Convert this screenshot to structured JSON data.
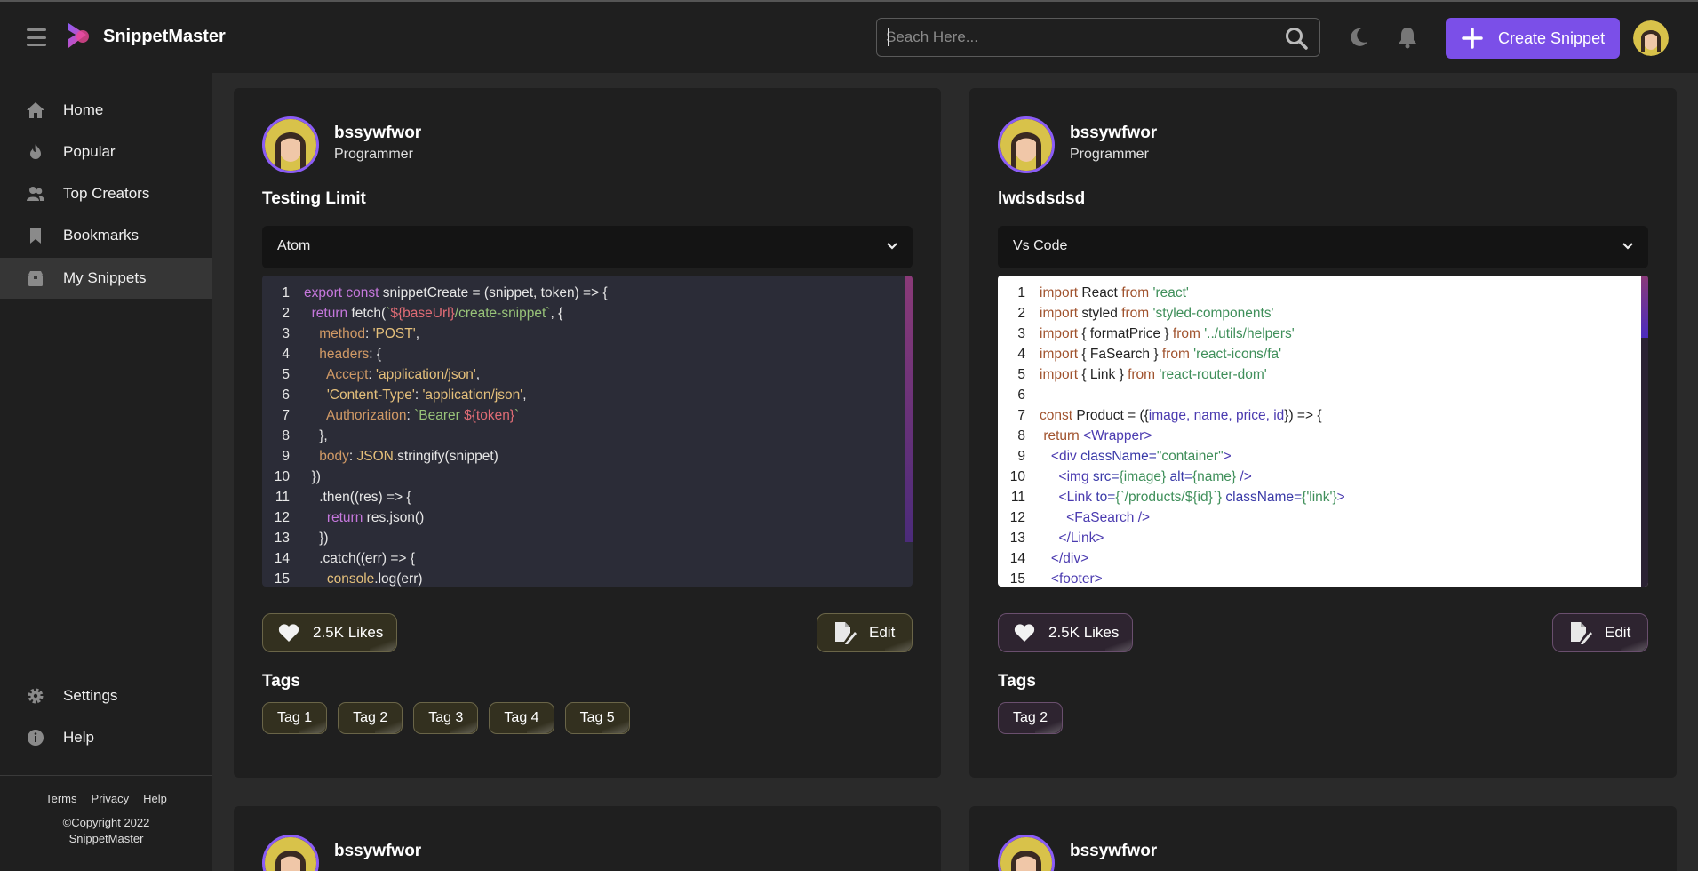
{
  "app": {
    "name": "SnippetMaster"
  },
  "search": {
    "placeholder": "Seach Here..."
  },
  "header": {
    "create_label": "Create Snippet"
  },
  "sidebar": {
    "items": [
      {
        "label": "Home",
        "icon": "home-icon"
      },
      {
        "label": "Popular",
        "icon": "fire-icon"
      },
      {
        "label": "Top Creators",
        "icon": "users-icon"
      },
      {
        "label": "Bookmarks",
        "icon": "bookmark-icon"
      },
      {
        "label": "My Snippets",
        "icon": "box-icon",
        "active": true
      }
    ],
    "bottom_items": [
      {
        "label": "Settings",
        "icon": "gear-icon"
      },
      {
        "label": "Help",
        "icon": "info-icon"
      }
    ],
    "footer_links": [
      "Terms",
      "Privacy",
      "Help"
    ],
    "copyright_line1": "©Copyright 2022",
    "copyright_line2": "SnippetMaster"
  },
  "cards": [
    {
      "username": "bssywfwor",
      "role": "Programmer",
      "title": "Testing Limit",
      "editor": "Atom",
      "likes": "2.5K Likes",
      "edit_label": "Edit",
      "tags_heading": "Tags",
      "tags": [
        "Tag 1",
        "Tag 2",
        "Tag 3",
        "Tag 4",
        "Tag 5"
      ]
    },
    {
      "username": "bssywfwor",
      "role": "Programmer",
      "title": "lwdsdsdsd",
      "editor": "Vs Code",
      "likes": "2.5K Likes",
      "edit_label": "Edit",
      "tags_heading": "Tags",
      "tags": [
        "Tag 2"
      ]
    },
    {
      "username": "bssywfwor"
    },
    {
      "username": "bssywfwor"
    }
  ],
  "code": {
    "card1": [
      "export const snippetCreate = (snippet, token) => {",
      "  return fetch(`${baseUrl}/create-snippet`, {",
      "    method: 'POST',",
      "    headers: {",
      "      Accept: 'application/json',",
      "      'Content-Type': 'application/json',",
      "      Authorization: `Bearer ${token}`",
      "    },",
      "    body: JSON.stringify(snippet)",
      "  })",
      "    .then((res) => {",
      "      return res.json()",
      "    })",
      "    .catch((err) => {",
      "      console.log(err)"
    ],
    "card2": [
      "import React from 'react'",
      "import styled from 'styled-components'",
      "import { formatPrice } from '../utils/helpers'",
      "import { FaSearch } from 'react-icons/fa'",
      "import { Link } from 'react-router-dom'",
      "",
      "const Product = ({image, name, price, id}) => {",
      " return <Wrapper>",
      "   <div className=\"container\">",
      "     <img src={image} alt={name} />",
      "     <Link to={`/products/${id}`} className={'link'}>",
      "       <FaSearch />",
      "     </Link>",
      "   </div>",
      "   <footer>"
    ]
  },
  "colors": {
    "accent": "#7b4fe8",
    "background": "#2a2a2a",
    "panel": "#1f1f1f"
  }
}
